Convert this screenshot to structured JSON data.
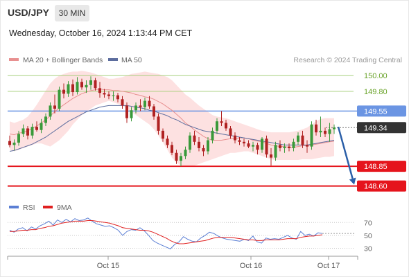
{
  "header": {
    "symbol": "USD/JPY",
    "timeframe": "30 MIN",
    "timestamp": "Wednesday, October 16, 2024 1:13:44 PM CET"
  },
  "legend": {
    "ma20_label": "MA 20 + Bollinger Bands",
    "ma50_label": "MA 50",
    "copyright": "Research © 2024 Trading Central",
    "rsi_label": "RSI",
    "ma9_label": "9MA"
  },
  "colors": {
    "up_candle": "#3a9a3a",
    "down_candle": "#b02222",
    "ma20": "#e89090",
    "bollinger_fill": "#fde1e1",
    "ma50": "#5c6d9e",
    "resistance": "#a8cf7d",
    "pivot": "#6b95e3",
    "support": "#e5141c",
    "current_price": "#333333",
    "projection_arrow": "#2b5fa8",
    "rsi": "#5b7fd4",
    "rsi_ma": "#e02020"
  },
  "chart_data": [
    {
      "type": "candlestick",
      "title": "USD/JPY",
      "timeframe": "30 MIN",
      "ylim": [
        148.5,
        150.08
      ],
      "x_ticks": [
        "Oct 15",
        "Oct 16",
        "Oct 17"
      ],
      "levels": [
        {
          "value": 150.0,
          "label": "150.00",
          "role": "resistance"
        },
        {
          "value": 149.8,
          "label": "149.80",
          "role": "resistance"
        },
        {
          "value": 149.55,
          "label": "149.55",
          "role": "pivot"
        },
        {
          "value": 149.34,
          "label": "149.34",
          "role": "current"
        },
        {
          "value": 148.85,
          "label": "148.85",
          "role": "support"
        },
        {
          "value": 148.6,
          "label": "148.60",
          "role": "support"
        }
      ],
      "projection": {
        "from": 149.35,
        "to": 148.6
      },
      "candles": [
        [
          149.17,
          149.24,
          149.09,
          149.12
        ],
        [
          149.12,
          149.19,
          149.05,
          149.15
        ],
        [
          149.15,
          149.3,
          149.11,
          149.26
        ],
        [
          149.26,
          149.38,
          149.22,
          149.33
        ],
        [
          149.33,
          149.36,
          149.19,
          149.24
        ],
        [
          149.24,
          149.39,
          149.2,
          149.35
        ],
        [
          149.35,
          149.42,
          149.29,
          149.31
        ],
        [
          149.31,
          149.45,
          149.27,
          149.4
        ],
        [
          149.4,
          149.52,
          149.36,
          149.48
        ],
        [
          149.48,
          149.66,
          149.44,
          149.62
        ],
        [
          149.62,
          149.76,
          149.52,
          149.58
        ],
        [
          149.58,
          149.86,
          149.55,
          149.82
        ],
        [
          149.82,
          149.9,
          149.71,
          149.77
        ],
        [
          149.77,
          149.93,
          149.73,
          149.89
        ],
        [
          149.89,
          149.95,
          149.74,
          149.79
        ],
        [
          149.79,
          149.98,
          149.76,
          149.92
        ],
        [
          149.92,
          149.96,
          149.82,
          149.85
        ],
        [
          149.85,
          149.94,
          149.78,
          149.88
        ],
        [
          149.88,
          149.99,
          149.82,
          149.94
        ],
        [
          149.94,
          149.97,
          149.81,
          149.84
        ],
        [
          149.84,
          149.92,
          149.72,
          149.78
        ],
        [
          149.78,
          149.83,
          149.72,
          149.76
        ],
        [
          149.76,
          149.8,
          149.7,
          149.74
        ],
        [
          149.74,
          149.8,
          149.68,
          149.75
        ],
        [
          149.75,
          149.78,
          149.66,
          149.7
        ],
        [
          149.7,
          149.74,
          149.58,
          149.62
        ],
        [
          149.62,
          149.66,
          149.4,
          149.46
        ],
        [
          149.46,
          149.6,
          149.42,
          149.56
        ],
        [
          149.56,
          149.66,
          149.52,
          149.62
        ],
        [
          149.62,
          149.7,
          149.55,
          149.6
        ],
        [
          149.6,
          149.72,
          149.56,
          149.68
        ],
        [
          149.68,
          149.74,
          149.58,
          149.61
        ],
        [
          149.61,
          149.64,
          149.44,
          149.48
        ],
        [
          149.48,
          149.52,
          149.25,
          149.3
        ],
        [
          149.3,
          149.33,
          149.16,
          149.2
        ],
        [
          149.2,
          149.24,
          149.08,
          149.12
        ],
        [
          149.12,
          149.16,
          148.99,
          149.02
        ],
        [
          149.02,
          149.06,
          148.88,
          148.92
        ],
        [
          148.92,
          149.02,
          148.85,
          148.98
        ],
        [
          148.98,
          149.1,
          148.94,
          149.06
        ],
        [
          149.06,
          149.28,
          149.02,
          149.24
        ],
        [
          149.24,
          149.3,
          149.12,
          149.16
        ],
        [
          149.16,
          149.22,
          149.04,
          149.08
        ],
        [
          149.08,
          149.12,
          148.98,
          149.04
        ],
        [
          149.04,
          149.22,
          149.0,
          149.18
        ],
        [
          149.18,
          149.34,
          149.14,
          149.3
        ],
        [
          149.3,
          149.46,
          149.26,
          149.42
        ],
        [
          149.42,
          149.55,
          149.36,
          149.4
        ],
        [
          149.4,
          149.44,
          149.3,
          149.33
        ],
        [
          149.33,
          149.36,
          149.2,
          149.24
        ],
        [
          149.24,
          149.28,
          149.14,
          149.18
        ],
        [
          149.18,
          149.22,
          149.12,
          149.16
        ],
        [
          149.16,
          149.2,
          149.1,
          149.14
        ],
        [
          149.14,
          149.18,
          149.08,
          149.1
        ],
        [
          149.1,
          149.16,
          149.04,
          149.12
        ],
        [
          149.12,
          149.15,
          149.0,
          149.06
        ],
        [
          149.06,
          149.22,
          149.02,
          149.2
        ],
        [
          149.2,
          149.24,
          148.96,
          149.0
        ],
        [
          149.0,
          149.08,
          148.86,
          148.96
        ],
        [
          148.96,
          149.16,
          148.92,
          149.12
        ],
        [
          149.12,
          149.18,
          149.04,
          149.08
        ],
        [
          149.08,
          149.14,
          149.02,
          149.1
        ],
        [
          149.1,
          149.14,
          149.04,
          149.08
        ],
        [
          149.08,
          149.2,
          149.04,
          149.16
        ],
        [
          149.16,
          149.28,
          149.12,
          149.24
        ],
        [
          149.24,
          149.3,
          149.08,
          149.12
        ],
        [
          149.12,
          149.18,
          149.02,
          149.1
        ],
        [
          149.1,
          149.42,
          149.06,
          149.38
        ],
        [
          149.38,
          149.44,
          149.24,
          149.28
        ],
        [
          149.28,
          149.48,
          149.22,
          149.3
        ],
        [
          149.3,
          149.34,
          149.22,
          149.26
        ],
        [
          149.26,
          149.4,
          149.16,
          149.32
        ],
        [
          149.32,
          149.38,
          149.26,
          149.34
        ]
      ],
      "ma20": [
        149.26,
        149.25,
        149.27,
        149.28,
        149.3,
        149.33,
        149.36,
        149.4,
        149.44,
        149.49,
        149.54,
        149.59,
        149.63,
        149.67,
        149.71,
        149.74,
        149.77,
        149.79,
        149.81,
        149.82,
        149.83,
        149.82,
        149.82,
        149.81,
        149.81,
        149.8,
        149.79,
        149.78,
        149.76,
        149.75,
        149.73,
        149.72,
        149.7,
        149.67,
        149.64,
        149.6,
        149.56,
        149.51,
        149.46,
        149.4,
        149.36,
        149.31,
        149.27,
        149.23,
        149.2,
        149.18,
        149.18,
        149.18,
        149.19,
        149.2,
        149.2,
        149.21,
        149.21,
        149.2,
        149.18,
        149.17,
        149.16,
        149.14,
        149.12,
        149.11,
        149.1,
        149.1,
        149.09,
        149.09,
        149.1,
        149.11,
        149.11,
        149.12,
        149.13,
        149.14,
        149.15,
        149.16,
        149.17
      ],
      "bollinger_upper": [
        149.42,
        149.4,
        149.42,
        149.44,
        149.48,
        149.55,
        149.63,
        149.72,
        149.81,
        149.9,
        149.96,
        150.0,
        150.02,
        150.04,
        150.05,
        150.05,
        150.06,
        150.05,
        150.04,
        150.02,
        150.0,
        149.98,
        149.96,
        149.96,
        149.97,
        149.98,
        150.0,
        150.02,
        150.03,
        150.04,
        150.05,
        150.04,
        150.03,
        150.02,
        150.0,
        149.98,
        149.94,
        149.88,
        149.82,
        149.76,
        149.72,
        149.67,
        149.62,
        149.58,
        149.54,
        149.5,
        149.48,
        149.47,
        149.46,
        149.44,
        149.42,
        149.4,
        149.38,
        149.36,
        149.34,
        149.32,
        149.3,
        149.29,
        149.28,
        149.28,
        149.28,
        149.28,
        149.28,
        149.29,
        149.3,
        149.32,
        149.34,
        149.38,
        149.42,
        149.45,
        149.46,
        149.46,
        149.46
      ],
      "bollinger_lower": [
        149.06,
        149.04,
        149.06,
        149.08,
        149.1,
        149.12,
        149.14,
        149.14,
        149.12,
        149.1,
        149.14,
        149.18,
        149.24,
        149.3,
        149.38,
        149.44,
        149.5,
        149.54,
        149.58,
        149.62,
        149.64,
        149.66,
        149.68,
        149.66,
        149.64,
        149.62,
        149.58,
        149.54,
        149.5,
        149.46,
        149.42,
        149.38,
        149.32,
        149.24,
        149.15,
        149.06,
        148.96,
        148.9,
        148.86,
        148.85,
        148.85,
        148.86,
        148.88,
        148.9,
        148.92,
        148.94,
        148.96,
        148.98,
        149.0,
        149.02,
        149.02,
        149.03,
        149.04,
        149.04,
        149.02,
        149.0,
        148.98,
        148.96,
        148.94,
        148.93,
        148.93,
        148.93,
        148.93,
        148.93,
        148.93,
        148.94,
        148.94,
        148.94,
        148.95,
        148.96,
        148.97,
        148.97,
        148.98
      ],
      "ma50": [
        149.04,
        149.05,
        149.07,
        149.09,
        149.11,
        149.13,
        149.16,
        149.19,
        149.22,
        149.26,
        149.3,
        149.34,
        149.38,
        149.42,
        149.45,
        149.48,
        149.51,
        149.54,
        149.56,
        149.58,
        149.6,
        149.61,
        149.62,
        149.62,
        149.62,
        149.62,
        149.62,
        149.61,
        149.6,
        149.59,
        149.58,
        149.56,
        149.55,
        149.53,
        149.51,
        149.49,
        149.46,
        149.44,
        149.41,
        149.38,
        149.36,
        149.34,
        149.32,
        149.3,
        149.29,
        149.28,
        149.27,
        149.26,
        149.25,
        149.24,
        149.23,
        149.22,
        149.21,
        149.2,
        149.19,
        149.18,
        149.17,
        149.16,
        149.15,
        149.14,
        149.13,
        149.12,
        149.12,
        149.12,
        149.12,
        149.12,
        149.12,
        149.13,
        149.14,
        149.15,
        149.16,
        149.17,
        149.18
      ]
    },
    {
      "type": "line",
      "title": "RSI",
      "ylim": [
        22,
        80
      ],
      "y_ticks": [
        70,
        50,
        30
      ],
      "series": [
        {
          "name": "RSI",
          "values": [
            58,
            55,
            60,
            62,
            57,
            63,
            60,
            65,
            68,
            72,
            66,
            74,
            70,
            75,
            71,
            76,
            73,
            74,
            77,
            72,
            68,
            66,
            64,
            65,
            62,
            58,
            50,
            56,
            59,
            58,
            62,
            57,
            50,
            42,
            38,
            35,
            32,
            29,
            36,
            40,
            48,
            44,
            41,
            40,
            46,
            50,
            55,
            53,
            49,
            46,
            44,
            43,
            42,
            41,
            44,
            42,
            49,
            40,
            38,
            46,
            44,
            45,
            44,
            47,
            50,
            46,
            44,
            56,
            50,
            52,
            49,
            54,
            53
          ]
        },
        {
          "name": "9MA",
          "values": [
            56,
            56,
            57,
            58,
            58,
            59,
            59,
            61,
            62,
            64,
            65,
            67,
            69,
            70,
            71,
            72,
            72,
            72,
            73,
            73,
            72,
            71,
            70,
            69,
            67,
            65,
            62,
            61,
            60,
            59,
            58,
            58,
            57,
            55,
            52,
            49,
            46,
            42,
            39,
            37,
            37,
            38,
            39,
            40,
            41,
            42,
            44,
            46,
            47,
            47,
            47,
            47,
            46,
            45,
            44,
            43,
            43,
            42,
            42,
            43,
            43,
            43,
            43,
            44,
            45,
            45,
            45,
            47,
            48,
            49,
            49,
            50,
            51
          ]
        }
      ]
    }
  ]
}
